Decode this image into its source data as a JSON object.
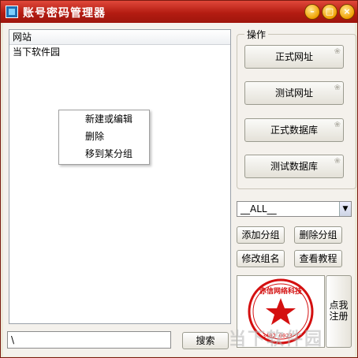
{
  "window": {
    "title": "账号密码管理器"
  },
  "list": {
    "header": "网站",
    "items": [
      "当下软件园"
    ]
  },
  "context_menu": {
    "items": [
      "新建或编辑",
      "删除",
      "移到某分组"
    ]
  },
  "operations": {
    "title": "操作",
    "buttons": [
      "正式网址",
      "测试网址",
      "正式数据库",
      "测试数据库"
    ]
  },
  "group_select": {
    "value": "__ALL__"
  },
  "group_buttons": {
    "add": "添加分组",
    "delete": "删除分组",
    "rename": "修改组名",
    "tutorial": "查看教程"
  },
  "stamp": {
    "text": "赤信网络科技"
  },
  "side_button": {
    "label": "点我注册"
  },
  "search": {
    "value": "\\",
    "button": "搜索"
  },
  "watermark": {
    "text": "当下软件园"
  },
  "colors": {
    "titlebar": "#b41c12",
    "stamp": "#d41010"
  }
}
